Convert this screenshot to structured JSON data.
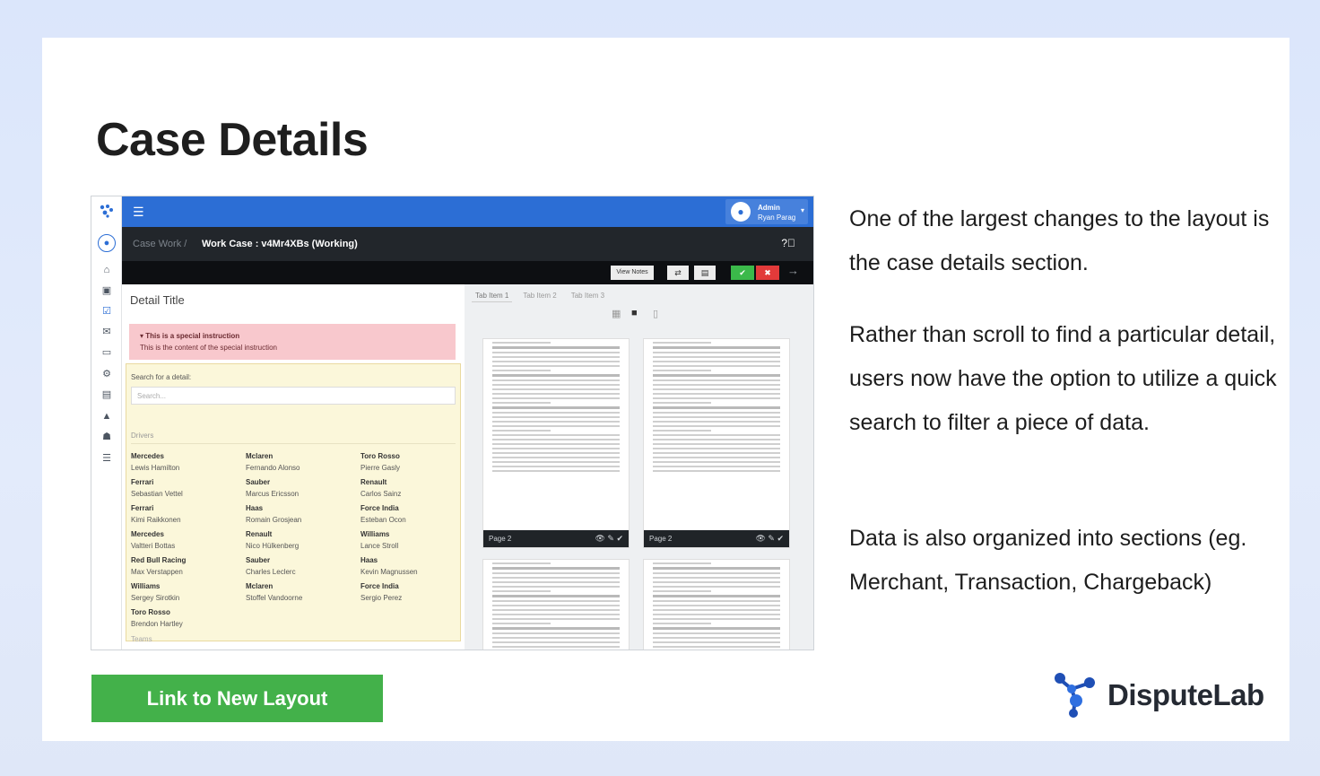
{
  "slide": {
    "title": "Case Details",
    "paragraphs": [
      "One of the largest changes to the layout is the case details section.",
      "Rather than scroll to find a particular detail, users now have the option to utilize a quick search to filter a piece of data.",
      "Data is also organized into sections (eg. Merchant, Transaction, Chargeback)"
    ],
    "cta_label": "Link to New Layout",
    "brand_name": "DisputeLab"
  },
  "app": {
    "user": {
      "role": "Admin",
      "name": "Ryan Parag"
    },
    "breadcrumb": {
      "parent": "Case Work /",
      "current": "Work Case : v4Mr4XBs (Working)"
    },
    "actions": {
      "view_notes": "View Notes"
    },
    "detail": {
      "title": "Detail Title",
      "special_heading": "▾ This is a special instruction",
      "special_body": "This is the content of the special instruction",
      "search_label": "Search for a detail:",
      "search_placeholder": "Search...",
      "section_label": "Drivers",
      "next_section_label": "Teams",
      "drivers": [
        {
          "team": "Mercedes",
          "driver": "Lewis Hamilton"
        },
        {
          "team": "Mclaren",
          "driver": "Fernando Alonso"
        },
        {
          "team": "Toro Rosso",
          "driver": "Pierre Gasly"
        },
        {
          "team": "Ferrari",
          "driver": "Sebastian Vettel"
        },
        {
          "team": "Sauber",
          "driver": "Marcus Ericsson"
        },
        {
          "team": "Renault",
          "driver": "Carlos Sainz"
        },
        {
          "team": "Ferrari",
          "driver": "Kimi Raikkonen"
        },
        {
          "team": "Haas",
          "driver": "Romain Grosjean"
        },
        {
          "team": "Force India",
          "driver": "Esteban Ocon"
        },
        {
          "team": "Mercedes",
          "driver": "Valtteri Bottas"
        },
        {
          "team": "Renault",
          "driver": "Nico Hülkenberg"
        },
        {
          "team": "Williams",
          "driver": "Lance Stroll"
        },
        {
          "team": "Red Bull Racing",
          "driver": "Max Verstappen"
        },
        {
          "team": "Sauber",
          "driver": "Charles Leclerc"
        },
        {
          "team": "Haas",
          "driver": "Kevin Magnussen"
        },
        {
          "team": "Williams",
          "driver": "Sergey Sirotkin"
        },
        {
          "team": "Mclaren",
          "driver": "Stoffel Vandoorne"
        },
        {
          "team": "Force India",
          "driver": "Sergio Perez"
        },
        {
          "team": "Toro Rosso",
          "driver": "Brendon Hartley"
        }
      ]
    },
    "docs": {
      "tabs": [
        "Tab Item 1",
        "Tab Item 2",
        "Tab Item 3"
      ],
      "page_label_1": "Page 2",
      "page_label_2": "Page 2"
    }
  },
  "icons": [
    "logo-icon",
    "user-icon",
    "home-icon",
    "briefcase-icon",
    "check-square-icon",
    "mail-icon",
    "card-icon",
    "gear-icon",
    "file-icon",
    "warning-icon",
    "users-icon",
    "list-icon"
  ],
  "colors": {
    "primary_blue": "#2c6ed5",
    "cta_green": "#43b14a",
    "alert_pink": "#f8c8cd",
    "search_yellow": "#fbf7da"
  }
}
